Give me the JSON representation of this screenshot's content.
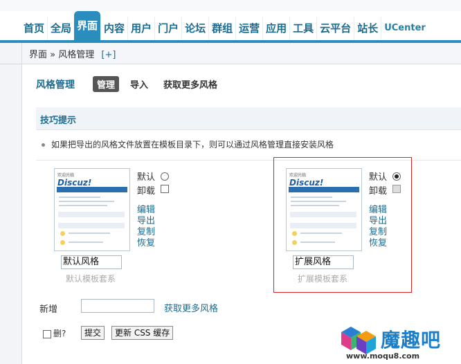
{
  "nav": {
    "items": [
      {
        "label": "首页"
      },
      {
        "label": "全局"
      },
      {
        "label": "界面",
        "active": true
      },
      {
        "label": "内容"
      },
      {
        "label": "用户"
      },
      {
        "label": "门户"
      },
      {
        "label": "论坛"
      },
      {
        "label": "群组"
      },
      {
        "label": "运营"
      },
      {
        "label": "应用"
      },
      {
        "label": "工具"
      },
      {
        "label": "云平台"
      },
      {
        "label": "站长"
      },
      {
        "label": "UCenter"
      }
    ]
  },
  "breadcrumb": {
    "root": "界面",
    "sep": "»",
    "current": "风格管理",
    "add": "[+]"
  },
  "page": {
    "title": "风格管理",
    "tabs": [
      {
        "label": "管理",
        "active": true
      },
      {
        "label": "导入"
      },
      {
        "label": "获取更多风格"
      }
    ]
  },
  "tips": {
    "heading": "技巧提示",
    "line": "如果把导出的风格文件放置在模板目录下，则可以通过风格管理直接安装风格"
  },
  "styles": [
    {
      "name": "默认风格",
      "subtitle": "默认模板套系",
      "default_label": "默认",
      "default_selected": false,
      "uninstall_label": "卸载",
      "uninstall_disabled": false,
      "actions": [
        "编辑",
        "导出",
        "复制",
        "恢复"
      ],
      "thumb_logo": "Discuz!",
      "thumb_tag": "欢迎光临"
    },
    {
      "name": "扩展风格",
      "subtitle": "扩展模板套系",
      "default_label": "默认",
      "default_selected": true,
      "uninstall_label": "卸载",
      "uninstall_disabled": true,
      "actions": [
        "编辑",
        "导出",
        "复制",
        "恢复"
      ],
      "thumb_logo": "Discuz!",
      "thumb_tag": "欢迎光临"
    }
  ],
  "add": {
    "label": "新增",
    "value": "",
    "link": "获取更多风格"
  },
  "footer": {
    "delete_label": "删?",
    "submit": "提交",
    "update_css": "更新 CSS 缓存"
  },
  "watermark": {
    "text": "魔趣吧",
    "url": "www.moqu8.com"
  },
  "colors": {
    "accent": "#2a8dbd",
    "link": "#1b6b8f",
    "highlight_frame": "#dd2222"
  }
}
